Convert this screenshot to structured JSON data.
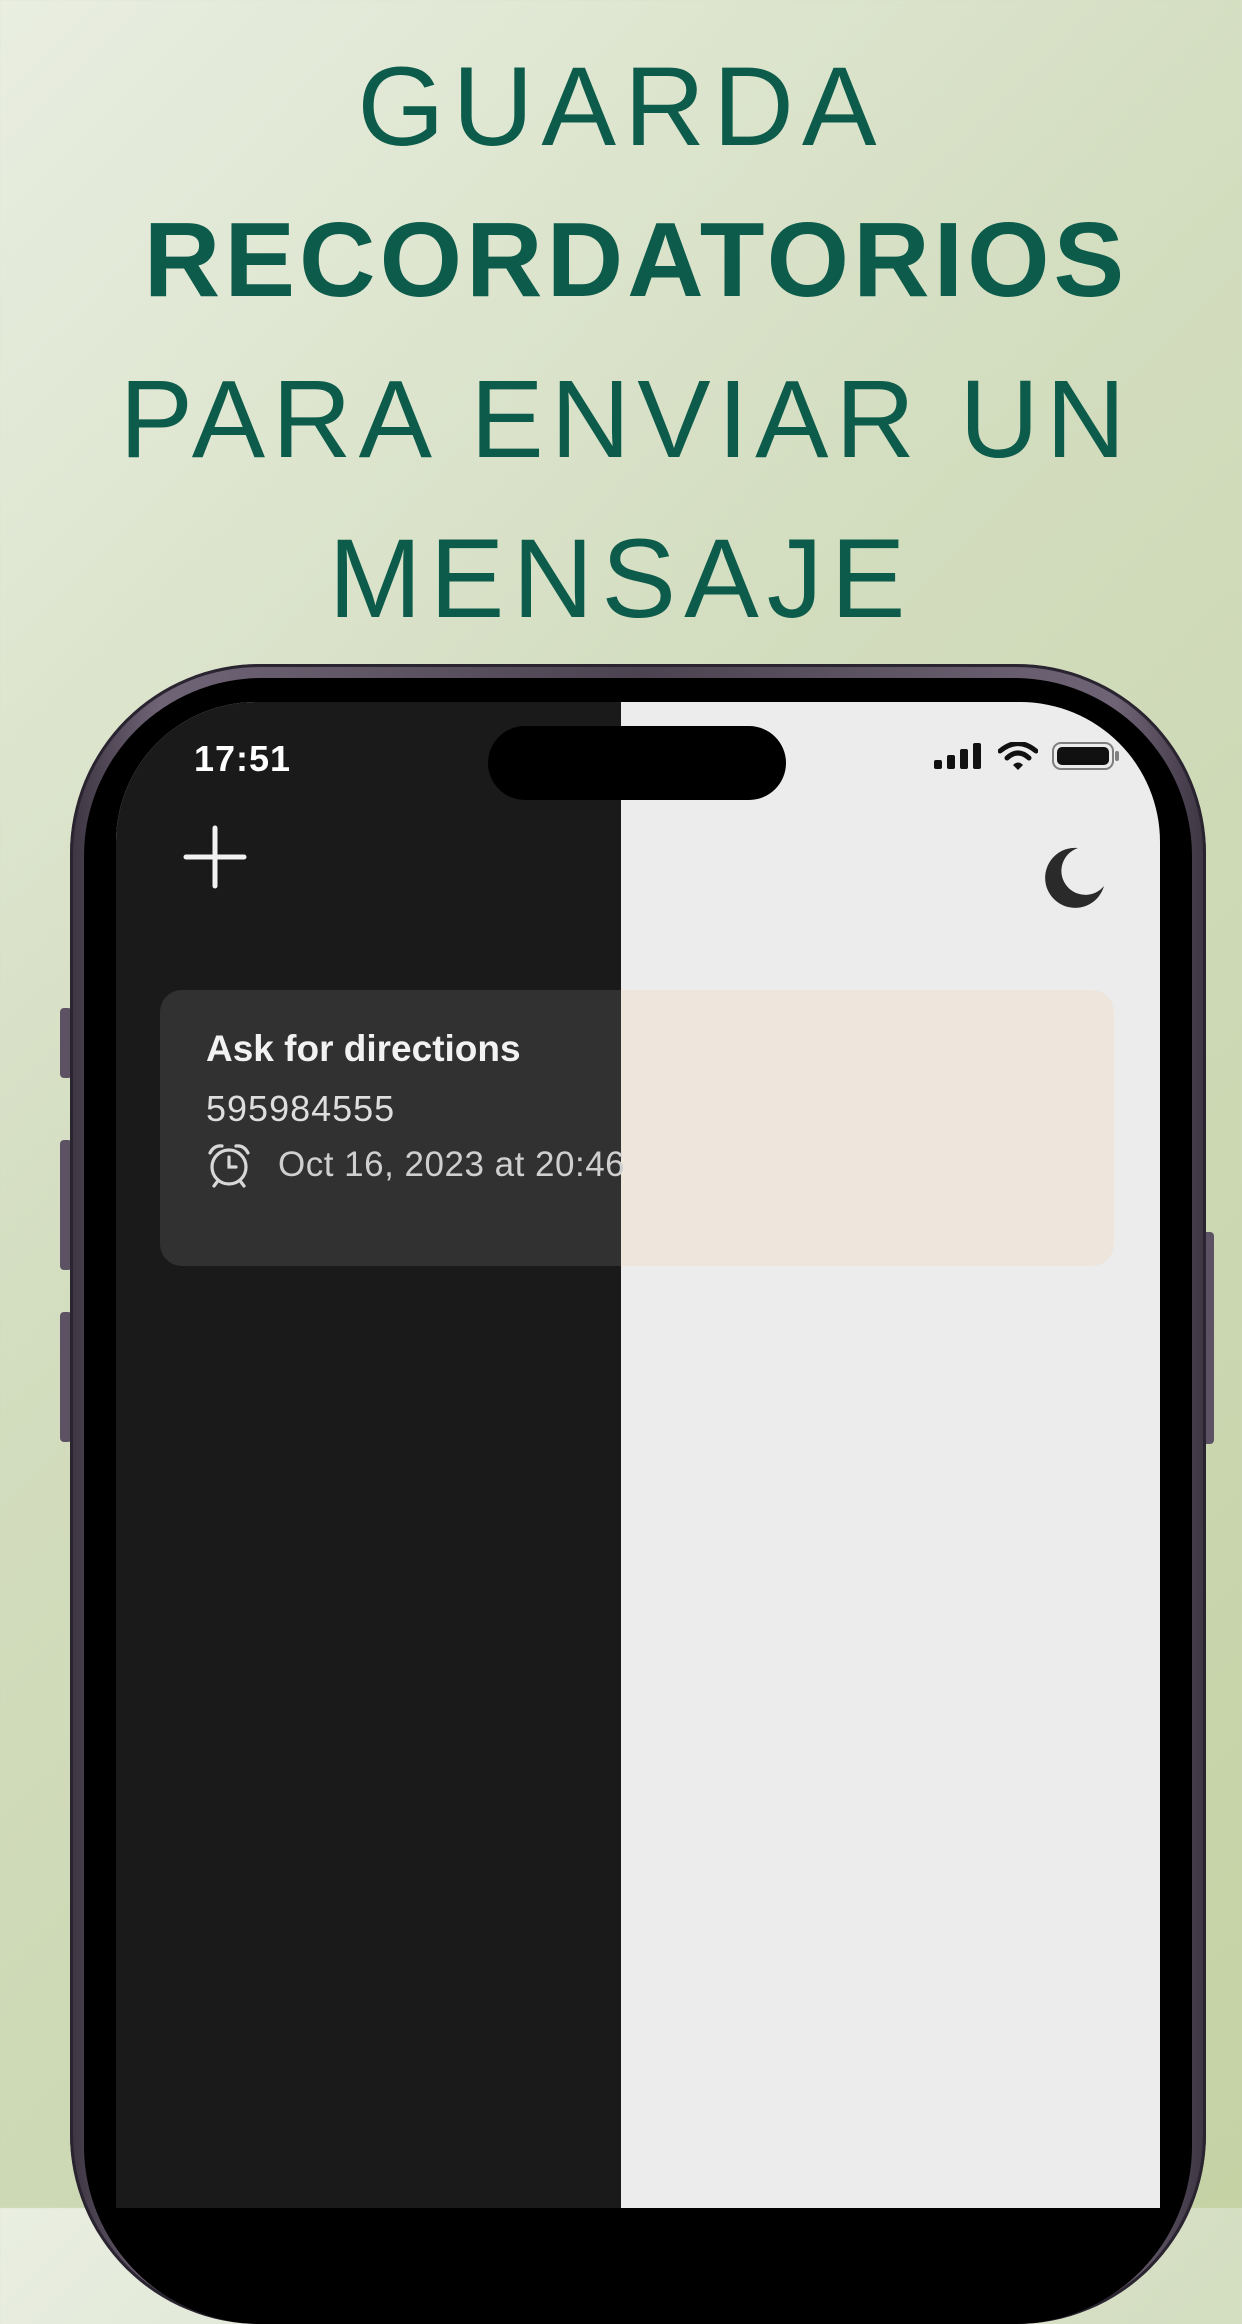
{
  "headline": {
    "line1": "GUARDA",
    "line2": "RECORDATORIOS",
    "line3": "PARA ENVIAR UN",
    "line4": "MENSAJE"
  },
  "status_bar": {
    "time": "17:51",
    "icons": [
      "cellular-signal-icon",
      "wifi-icon",
      "battery-icon"
    ]
  },
  "toolbar": {
    "add_icon": "plus-icon",
    "theme_icon": "moon-icon"
  },
  "reminders": [
    {
      "title": "Ask for directions",
      "phone": "595984555",
      "alarm_icon": "alarm-clock-icon",
      "datetime": "Oct 16, 2023 at 20:46"
    }
  ],
  "colors": {
    "headline": "#0d5c4b",
    "dark_background": "#1a1a1a",
    "light_background": "#ececed",
    "card_dark": "#313131",
    "card_light": "#eee6dd"
  }
}
